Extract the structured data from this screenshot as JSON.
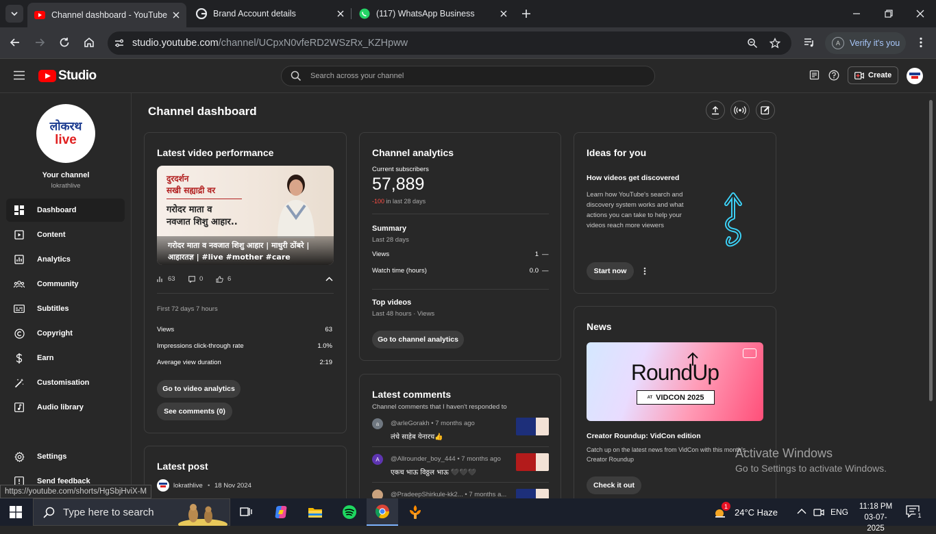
{
  "browser": {
    "tabs": [
      {
        "title": "Channel dashboard - YouTube Studio",
        "active": true
      },
      {
        "title": "Brand Account details",
        "active": false
      },
      {
        "title": "(117) WhatsApp Business",
        "active": false
      }
    ],
    "url_host": "studio.youtube.com",
    "url_path": "/channel/UCpxN0vfeRD2WSzRx_KZHpww",
    "verify_label": "Verify it's you",
    "verify_avatar": "A"
  },
  "header": {
    "logo_text": "Studio",
    "search_placeholder": "Search across your channel",
    "create_label": "Create"
  },
  "sidebar": {
    "avatar_line1": "लोकरथ",
    "avatar_line2": "live",
    "your_channel": "Your channel",
    "handle": "lokrathlive",
    "items": [
      {
        "label": "Dashboard",
        "icon": "dashboard-icon",
        "active": true
      },
      {
        "label": "Content",
        "icon": "content-icon"
      },
      {
        "label": "Analytics",
        "icon": "analytics-icon"
      },
      {
        "label": "Community",
        "icon": "community-icon"
      },
      {
        "label": "Subtitles",
        "icon": "subtitles-icon"
      },
      {
        "label": "Copyright",
        "icon": "copyright-icon"
      },
      {
        "label": "Earn",
        "icon": "earn-icon"
      },
      {
        "label": "Customisation",
        "icon": "customisation-icon"
      },
      {
        "label": "Audio library",
        "icon": "audio-library-icon"
      }
    ],
    "settings": "Settings",
    "feedback": "Send feedback"
  },
  "main": {
    "title": "Channel dashboard",
    "latest_video": {
      "heading": "Latest video performance",
      "thumb_line1": "दुरदर्शन",
      "thumb_line2": "सखी सह्याद्री वर",
      "thumb_line3": "गरोदर माता व",
      "thumb_line4": "नवजात शिशु आहार..",
      "thumb_caption1": "गरोदर माता व नवजात शिशु आहार | माधुरी ठोंबरे |",
      "thumb_caption2": "आहारतज्ञ | #live #mother #care #children #",
      "views_count": "63",
      "comments_count": "0",
      "likes_count": "6",
      "period": "First 72 days 7 hours",
      "rows": [
        {
          "label": "Views",
          "value": "63"
        },
        {
          "label": "Impressions click-through rate",
          "value": "1.0%"
        },
        {
          "label": "Average view duration",
          "value": "2:19"
        }
      ],
      "btn_analytics": "Go to video analytics",
      "btn_comments": "See comments (0)"
    },
    "latest_post": {
      "heading": "Latest post",
      "author": "lokrathlive",
      "date": "18 Nov 2024"
    },
    "analytics": {
      "heading": "Channel analytics",
      "subs_label": "Current subscribers",
      "subs_value": "57,889",
      "subs_delta": "-100",
      "subs_delta_period": "in last 28 days",
      "summary_label": "Summary",
      "summary_period": "Last 28 days",
      "rows": [
        {
          "label": "Views",
          "value": "1"
        },
        {
          "label": "Watch time (hours)",
          "value": "0.0"
        }
      ],
      "trend_mark": "—",
      "top_videos": "Top videos",
      "top_period": "Last 48 hours · Views",
      "btn": "Go to channel analytics"
    },
    "comments": {
      "heading": "Latest comments",
      "subtitle": "Channel comments that I haven't responded to",
      "items": [
        {
          "avatar": "a",
          "meta": "@arleGorakh • 7 months ago",
          "text": "लंचे साहेब येनारच👍"
        },
        {
          "avatar": "A",
          "meta": "@Allrounder_boy_444 • 7 months ago",
          "text": "एकच भाऊ विठ्ठल भाऊ 🖤🖤🖤"
        },
        {
          "avatar": "",
          "meta": "@PradeepShirkule-kk2... • 7 months a...",
          "text": ""
        }
      ]
    },
    "ideas": {
      "heading": "Ideas for you",
      "subheading": "How videos get discovered",
      "body": "Learn how YouTube's search and discovery system works and what actions you can take to help your videos reach more viewers",
      "btn": "Start now"
    },
    "news": {
      "heading": "News",
      "banner_title": "RoundUp",
      "banner_at": "AT",
      "banner_vidcon": "VIDCON 2025",
      "title": "Creator Roundup: VidCon edition",
      "body": "Catch up on the latest news from VidCon with this month's Creator Roundup",
      "btn": "Check it out"
    }
  },
  "overlay": {
    "activate_title": "Activate Windows",
    "activate_sub": "Go to Settings to activate Windows.",
    "status_url": "https://youtube.com/shorts/HgSbjHviX-M"
  },
  "taskbar": {
    "search_placeholder": "Type here to search",
    "weather_badge": "1",
    "weather": "24°C  Haze",
    "lang": "ENG",
    "time": "11:18 PM",
    "date": "03-07-2025",
    "notif": "1"
  },
  "colors": {
    "accent_red": "#ff0000",
    "delta_red": "#ff4e45",
    "link_blue": "#a8c7fa",
    "bg": "#282828"
  }
}
